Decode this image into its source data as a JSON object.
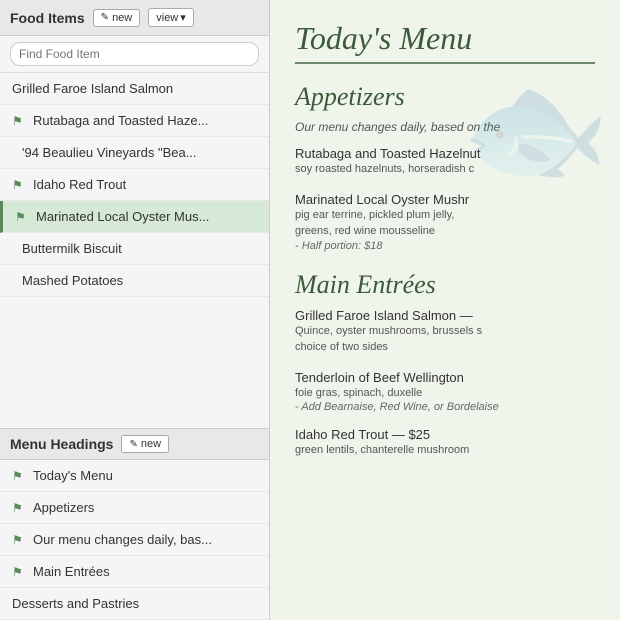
{
  "left": {
    "food_items_header": "Food Items",
    "btn_new": "new",
    "btn_view": "view",
    "search_placeholder": "Find Food Item",
    "food_items": [
      {
        "id": "grilled-faroe",
        "label": "Grilled Faroe Island Salmon",
        "icon": false,
        "indented": false,
        "active": false
      },
      {
        "id": "rutabaga",
        "label": "Rutabaga and Toasted Haze...",
        "icon": true,
        "indented": false,
        "active": false
      },
      {
        "id": "beaulieu",
        "label": "'94 Beaulieu Vineyards \"Bea...",
        "icon": false,
        "indented": true,
        "active": false
      },
      {
        "id": "idaho-trout",
        "label": "Idaho Red Trout",
        "icon": true,
        "indented": false,
        "active": false
      },
      {
        "id": "oyster",
        "label": "Marinated Local Oyster Mus...",
        "icon": true,
        "indented": false,
        "active": true
      },
      {
        "id": "buttermilk",
        "label": "Buttermilk Biscuit",
        "icon": false,
        "indented": true,
        "active": false
      },
      {
        "id": "mashed",
        "label": "Mashed Potatoes",
        "icon": false,
        "indented": true,
        "active": false
      }
    ],
    "menu_headings_header": "Menu Headings",
    "btn_new2": "new",
    "menu_headings": [
      {
        "id": "todays-menu",
        "label": "Today's Menu",
        "icon": true
      },
      {
        "id": "appetizers",
        "label": "Appetizers",
        "icon": true
      },
      {
        "id": "our-menu",
        "label": "Our menu changes daily, bas...",
        "icon": true
      },
      {
        "id": "main-entrees",
        "label": "Main Entrées",
        "icon": true
      },
      {
        "id": "desserts",
        "label": "Desserts and Pastries",
        "icon": false
      }
    ]
  },
  "right": {
    "title": "Today's Men",
    "title_suffix": "u",
    "sections": [
      {
        "id": "appetizers",
        "heading": "Appetizers",
        "intro": "Our menu changes daily, based on the",
        "items": [
          {
            "name": "Rutabaga and Toasted Hazelnut",
            "desc": "soy roasted hazelnuts, horseradish c",
            "sub": ""
          },
          {
            "name": "Marinated Local Oyster Mushr",
            "desc": "pig ear terrine, pickled plum jelly,",
            "desc2": "greens, red wine mousseline",
            "sub": "- Half portion: $18"
          }
        ]
      },
      {
        "id": "main-entrees",
        "heading": "Main Entrées",
        "intro": "",
        "items": [
          {
            "name": "Grilled Faroe Island Salmon —",
            "desc": "Quince, oyster mushrooms, brussels s",
            "desc2": "choice of two sides",
            "sub": ""
          },
          {
            "name": "Tenderloin of Beef Wellington",
            "desc": "foie gras, spinach, duxelle",
            "sub": "- Add Bearnaise, Red Wine, or Bordelaise"
          },
          {
            "name": "Idaho Red Trout — $25",
            "desc": "green lentils, chanterelle mushroom",
            "sub": ""
          }
        ]
      }
    ]
  }
}
